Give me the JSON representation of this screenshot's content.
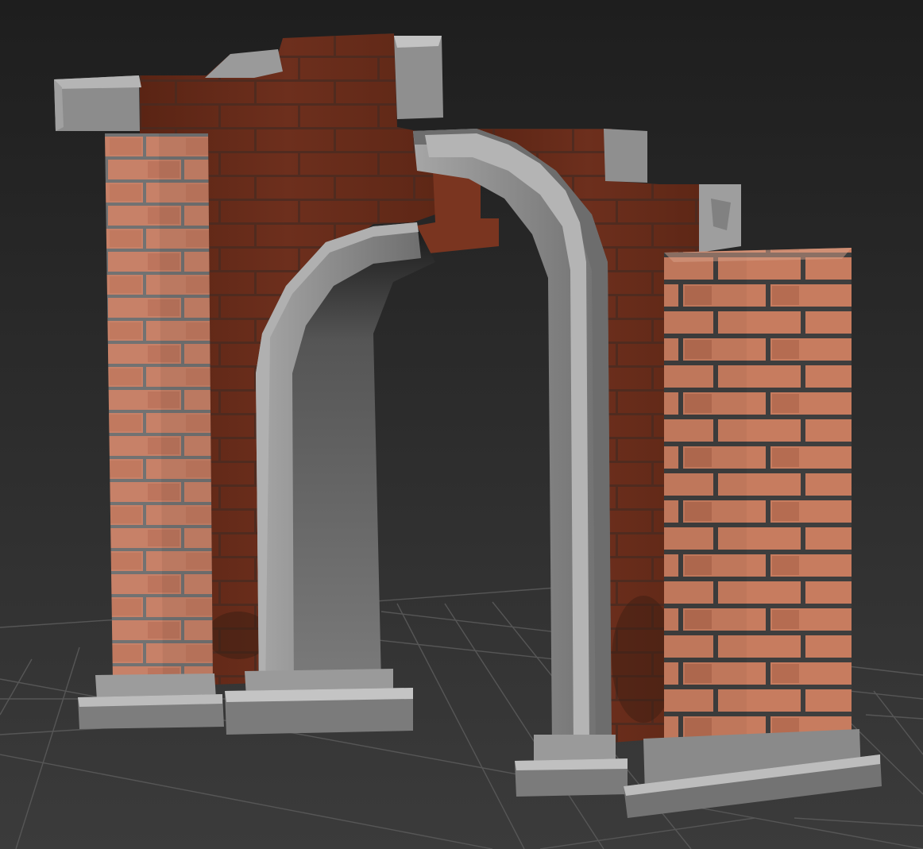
{
  "viewport": {
    "background_top": "#1f1f1f",
    "background_bottom": "#3a3a3a",
    "grid_color": "#5a5a5a"
  },
  "colors": {
    "brick_light": "#c47a5f",
    "brick_dark_wall": "#6b2e1e",
    "mortar": "#4a4a4a",
    "stone_trim": "#8e8e8e",
    "stone_highlight": "#c9c9c9",
    "stone_shadow": "#5c5c5c"
  }
}
